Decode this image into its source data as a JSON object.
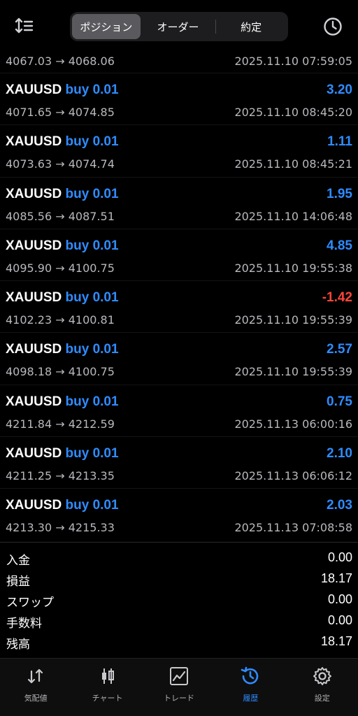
{
  "header": {
    "tabs": [
      {
        "label": "ポジション",
        "active": true
      },
      {
        "label": "オーダー",
        "active": false
      },
      {
        "label": "約定",
        "active": false
      }
    ]
  },
  "partial_row": {
    "prices": "4067.03 → 4068.06",
    "time": "2025.11.10 07:59:05"
  },
  "deals": [
    {
      "symbol": "XAUUSD",
      "side": "buy 0.01",
      "profit": "3.20",
      "prices": "4071.65 → 4074.85",
      "time": "2025.11.10 08:45:20"
    },
    {
      "symbol": "XAUUSD",
      "side": "buy 0.01",
      "profit": "1.11",
      "prices": "4073.63 → 4074.74",
      "time": "2025.11.10 08:45:21"
    },
    {
      "symbol": "XAUUSD",
      "side": "buy 0.01",
      "profit": "1.95",
      "prices": "4085.56 → 4087.51",
      "time": "2025.11.10 14:06:48"
    },
    {
      "symbol": "XAUUSD",
      "side": "buy 0.01",
      "profit": "4.85",
      "prices": "4095.90 → 4100.75",
      "time": "2025.11.10 19:55:38"
    },
    {
      "symbol": "XAUUSD",
      "side": "buy 0.01",
      "profit": "-1.42",
      "prices": "4102.23 → 4100.81",
      "time": "2025.11.10 19:55:39"
    },
    {
      "symbol": "XAUUSD",
      "side": "buy 0.01",
      "profit": "2.57",
      "prices": "4098.18 → 4100.75",
      "time": "2025.11.10 19:55:39"
    },
    {
      "symbol": "XAUUSD",
      "side": "buy 0.01",
      "profit": "0.75",
      "prices": "4211.84 → 4212.59",
      "time": "2025.11.13 06:00:16"
    },
    {
      "symbol": "XAUUSD",
      "side": "buy 0.01",
      "profit": "2.10",
      "prices": "4211.25 → 4213.35",
      "time": "2025.11.13 06:06:12"
    },
    {
      "symbol": "XAUUSD",
      "side": "buy 0.01",
      "profit": "2.03",
      "prices": "4213.30 → 4215.33",
      "time": "2025.11.13 07:08:58"
    }
  ],
  "summary": [
    {
      "label": "入金",
      "value": "0.00"
    },
    {
      "label": "損益",
      "value": "18.17"
    },
    {
      "label": "スワップ",
      "value": "0.00"
    },
    {
      "label": "手数料",
      "value": "0.00"
    },
    {
      "label": "残高",
      "value": "18.17"
    }
  ],
  "tabbar": [
    {
      "label": "気配値",
      "icon": "quotes-icon",
      "active": false
    },
    {
      "label": "チャート",
      "icon": "chart-candles-icon",
      "active": false
    },
    {
      "label": "トレード",
      "icon": "trade-icon",
      "active": false
    },
    {
      "label": "履歴",
      "icon": "history-icon",
      "active": true
    },
    {
      "label": "設定",
      "icon": "settings-icon",
      "active": false
    }
  ],
  "colors": {
    "positive": "#2f8cff",
    "negative": "#ff453a",
    "accent": "#2f8cff",
    "text_secondary": "#b9b9be"
  }
}
